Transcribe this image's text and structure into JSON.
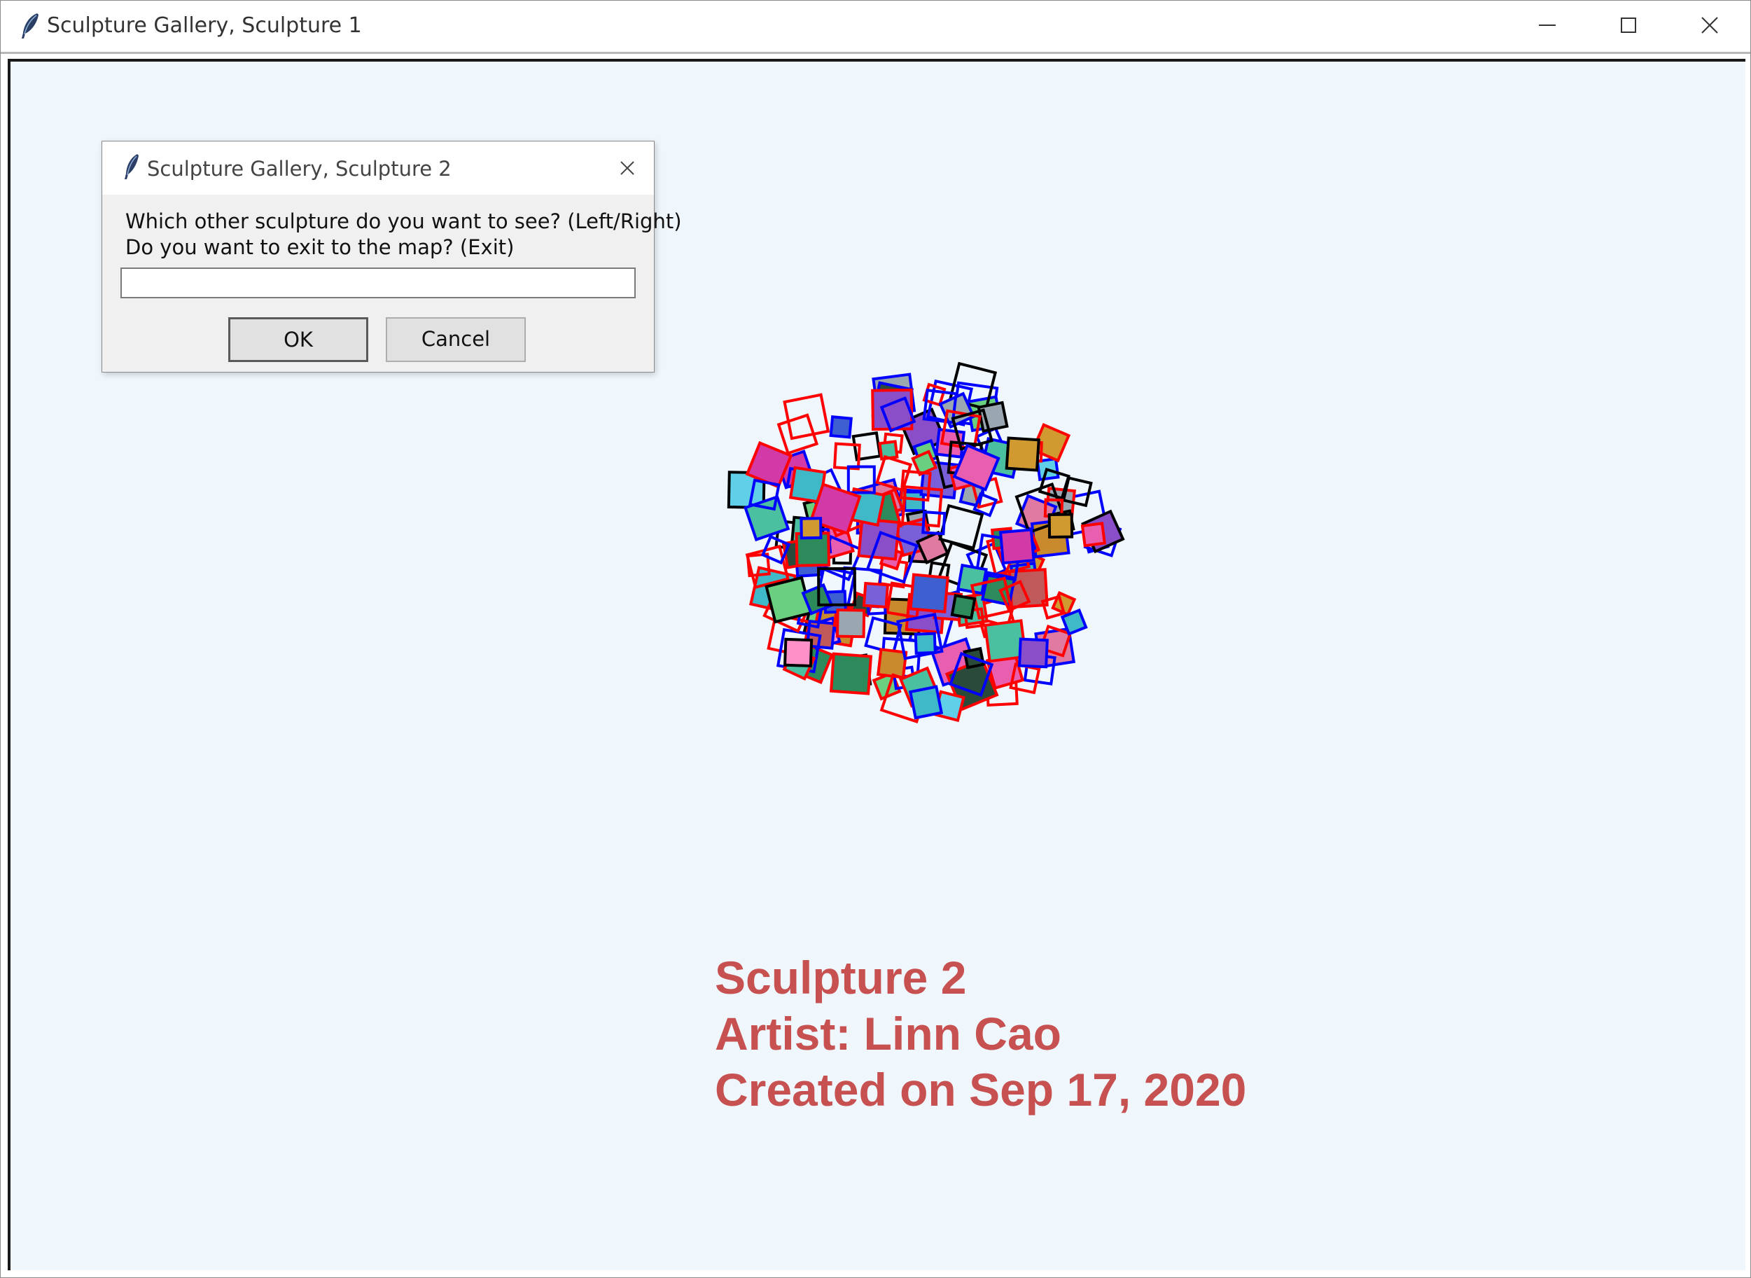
{
  "window": {
    "title": "Sculpture Gallery, Sculpture 1",
    "controls": [
      "minimize-icon",
      "maximize-icon",
      "close-icon"
    ]
  },
  "sculpture": {
    "heading": "Sculpture 2",
    "artist": "Artist: Linn Cao",
    "created": "Created on Sep 17, 2020",
    "text_color": "#c75050",
    "background": "#eff7fd"
  },
  "dialog": {
    "title": "Sculpture Gallery, Sculpture 2",
    "prompt_line1": "Which other sculpture do you want to see? (Left/Right)",
    "prompt_line2": "Do you want to exit to the map? (Exit)",
    "input_value": "",
    "ok_label": "OK",
    "cancel_label": "Cancel"
  }
}
